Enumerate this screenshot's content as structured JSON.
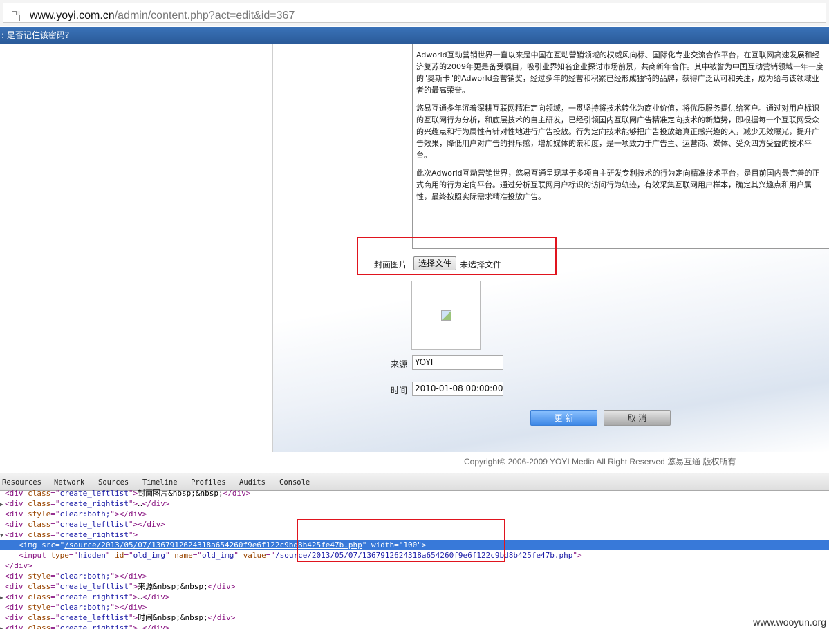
{
  "address_bar": {
    "host": "www.yoyi.com.cn",
    "path": "/admin/content.php?act=edit&id=367"
  },
  "infobar": {
    "text": ": 是否记住该密码?"
  },
  "editor": {
    "paragraphs": [
      "Adworld互动营销世界一直以来是中国在互动营销领域的权威风向标、国际化专业交流合作平台，在互联网高速发展和经济复苏的2009年更是备受瞩目，吸引业界知名企业探讨市场前景，共商新年合作。其中被誉为中国互动营销领域一年一度的\"奥斯卡\"的Adworld金营销奖，经过多年的经营和积累已经形成独特的品牌，获得广泛认可和关注，成为给与该领域业者的最高荣誉。",
      "悠易互通多年沉着深耕互联网精准定向领域，一贯坚持将技术转化为商业价值，将优质服务提供给客户。通过对用户标识的互联网行为分析，和底层技术的自主研发，已经引领国内互联网广告精准定向技术的新趋势，即根据每一个互联网受众的兴趣点和行为属性有针对性地进行广告投放。行为定向技术能够把广告投放给真正感兴趣的人，减少无效曝光，提升广告效果，降低用户对广告的排斥感，增加媒体的亲和度，是一项致力于广告主、运营商、媒体、受众四方受益的技术平台。",
      "此次Adworld互动营销世界，悠易互通呈现基于多项自主研发专利技术的行为定向精准技术平台，是目前国内最完善的正式商用的行为定向平台。通过分析互联网用户标识的访问行为轨迹，有效采集互联网用户样本，确定其兴趣点和用户属性，最终按照实际需求精准投放广告。"
    ]
  },
  "form": {
    "cover_label": "封面图片",
    "file_button": "选择文件",
    "file_status": "未选择文件",
    "source_label": "来源",
    "source_value": "YOYI",
    "time_label": "时间",
    "time_value": "2010-01-08 00:00:00",
    "update_button": "更 新",
    "cancel_button": "取 消"
  },
  "footer": {
    "copyright": "Copyright© 2006-2009 YOYI Media All Right Reserved 悠易互通 版权所有"
  },
  "devtools": {
    "tabs": [
      "Resources",
      "Network",
      "Sources",
      "Timeline",
      "Profiles",
      "Audits",
      "Console"
    ],
    "lines": [
      {
        "arrow": "",
        "parts": [
          [
            "tag",
            "<div "
          ],
          [
            "attr",
            "class"
          ],
          [
            "tag",
            "=\""
          ],
          [
            "val",
            "create_leftlist"
          ],
          [
            "tag",
            "\">"
          ],
          [
            "txt",
            "封面图片&nbsp;&nbsp;"
          ],
          [
            "tag",
            "</div>"
          ]
        ]
      },
      {
        "arrow": "▶",
        "parts": [
          [
            "tag",
            "<div "
          ],
          [
            "attr",
            "class"
          ],
          [
            "tag",
            "=\""
          ],
          [
            "val",
            "create_rightist"
          ],
          [
            "tag",
            "\">"
          ],
          [
            "txt",
            "…"
          ],
          [
            "tag",
            "</div>"
          ]
        ]
      },
      {
        "arrow": "",
        "parts": [
          [
            "tag",
            "<div "
          ],
          [
            "attr",
            "style"
          ],
          [
            "tag",
            "=\""
          ],
          [
            "val",
            "clear:both;"
          ],
          [
            "tag",
            "\"></div>"
          ]
        ]
      },
      {
        "arrow": "",
        "parts": [
          [
            "tag",
            "<div "
          ],
          [
            "attr",
            "class"
          ],
          [
            "tag",
            "=\""
          ],
          [
            "val",
            "create_leftlist"
          ],
          [
            "tag",
            "\"></div>"
          ]
        ]
      },
      {
        "arrow": "▼",
        "parts": [
          [
            "tag",
            "<div "
          ],
          [
            "attr",
            "class"
          ],
          [
            "tag",
            "=\""
          ],
          [
            "val",
            "create_rightist"
          ],
          [
            "tag",
            "\">"
          ]
        ]
      },
      {
        "arrow": "",
        "selected": true,
        "indent": 2,
        "parts": [
          [
            "tag",
            "<img "
          ],
          [
            "attr",
            "src"
          ],
          [
            "tag",
            "=\""
          ],
          [
            "val link",
            "/source/2013/05/07/1367912624318a654260f9e6f122c9bd8b425fe47b.php"
          ],
          [
            "tag",
            "\" "
          ],
          [
            "attr",
            "width"
          ],
          [
            "tag",
            "=\""
          ],
          [
            "val",
            "100"
          ],
          [
            "tag",
            "\">"
          ]
        ]
      },
      {
        "arrow": "",
        "indent": 2,
        "parts": [
          [
            "tag",
            "<input "
          ],
          [
            "attr",
            "type"
          ],
          [
            "tag",
            "=\""
          ],
          [
            "val",
            "hidden"
          ],
          [
            "tag",
            "\" "
          ],
          [
            "attr",
            "id"
          ],
          [
            "tag",
            "=\""
          ],
          [
            "val",
            "old_img"
          ],
          [
            "tag",
            "\" "
          ],
          [
            "attr",
            "name"
          ],
          [
            "tag",
            "=\""
          ],
          [
            "val",
            "old_img"
          ],
          [
            "tag",
            "\" "
          ],
          [
            "attr",
            "value"
          ],
          [
            "tag",
            "=\""
          ],
          [
            "val",
            "/source/2013/05/07/1367912624318a654260f9e6f122c9bd8b425fe47b.php"
          ],
          [
            "tag",
            "\">"
          ]
        ]
      },
      {
        "arrow": "",
        "parts": [
          [
            "tag",
            "</div>"
          ]
        ]
      },
      {
        "arrow": "",
        "parts": [
          [
            "tag",
            "<div "
          ],
          [
            "attr",
            "style"
          ],
          [
            "tag",
            "=\""
          ],
          [
            "val",
            "clear:both;"
          ],
          [
            "tag",
            "\"></div>"
          ]
        ]
      },
      {
        "arrow": "",
        "parts": [
          [
            "tag",
            "<div "
          ],
          [
            "attr",
            "class"
          ],
          [
            "tag",
            "=\""
          ],
          [
            "val",
            "create_leftlist"
          ],
          [
            "tag",
            "\">"
          ],
          [
            "txt",
            "来源&nbsp;&nbsp;"
          ],
          [
            "tag",
            "</div>"
          ]
        ]
      },
      {
        "arrow": "▶",
        "parts": [
          [
            "tag",
            "<div "
          ],
          [
            "attr",
            "class"
          ],
          [
            "tag",
            "=\""
          ],
          [
            "val",
            "create_rightist"
          ],
          [
            "tag",
            "\">"
          ],
          [
            "txt",
            "…"
          ],
          [
            "tag",
            "</div>"
          ]
        ]
      },
      {
        "arrow": "",
        "parts": [
          [
            "tag",
            "<div "
          ],
          [
            "attr",
            "style"
          ],
          [
            "tag",
            "=\""
          ],
          [
            "val",
            "clear:both;"
          ],
          [
            "tag",
            "\"></div>"
          ]
        ]
      },
      {
        "arrow": "",
        "parts": [
          [
            "tag",
            "<div "
          ],
          [
            "attr",
            "class"
          ],
          [
            "tag",
            "=\""
          ],
          [
            "val",
            "create_leftlist"
          ],
          [
            "tag",
            "\">"
          ],
          [
            "txt",
            "时间&nbsp;&nbsp;"
          ],
          [
            "tag",
            "</div>"
          ]
        ]
      },
      {
        "arrow": "▶",
        "parts": [
          [
            "tag",
            "<div "
          ],
          [
            "attr",
            "class"
          ],
          [
            "tag",
            "=\""
          ],
          [
            "val",
            "create_rightist"
          ],
          [
            "tag",
            "\">"
          ],
          [
            "txt",
            "…"
          ],
          [
            "tag",
            "</div>"
          ]
        ]
      }
    ]
  },
  "watermark": "www.wooyun.org"
}
